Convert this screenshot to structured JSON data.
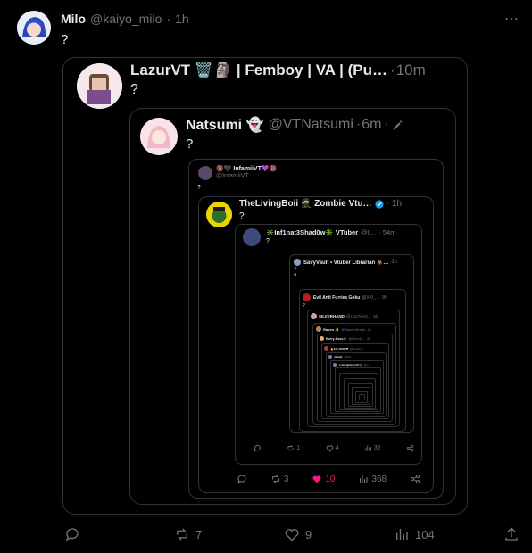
{
  "top": {
    "display_name": "Milo",
    "handle": "@kaiyo_milo",
    "time": "1h",
    "text": "?",
    "more": "⋯",
    "actions": {
      "replies": "",
      "reposts": "7",
      "likes": "9",
      "views": "104"
    }
  },
  "q1": {
    "display_name": "LazurVT 🗑️🗿 | Femboy | VA | (Pu…",
    "dot": "·",
    "time": "10m",
    "text": "?"
  },
  "q2": {
    "display_name": "Natsumi 👻",
    "handle": "@VTNatsumi",
    "dot": "·",
    "time": "6m",
    "text": "?"
  },
  "q3": {
    "display_name": "🔞🖤 InfamiiVT💜🔞",
    "handle": "@InfamiiVT",
    "text": "?"
  },
  "q4": {
    "display_name": "TheLivingBoii 🥷 Zombie Vtu…",
    "time": "1h",
    "text": "?",
    "actions": {
      "reposts": "3",
      "likes": "10",
      "views": "368"
    }
  },
  "q5": {
    "display_name": "✳️Inf1nat3Shad0w✳️ VTuber",
    "handle": "@I…",
    "time": "54m",
    "text": "?",
    "actions": {
      "reposts": "1",
      "likes": "4",
      "views": "32"
    }
  },
  "q6": {
    "display_name": "SavyVault • Vtuber Librarian 🐐…",
    "time": "3h",
    "text": "?"
  },
  "q7": {
    "display_name": "Evil Anti Furries Goku",
    "handle": "@XXI_…",
    "time": "8h",
    "text": "?"
  },
  "q8": {
    "display_name": "SILVERHAND",
    "handle": "@LowTierG…",
    "time": "6h"
  },
  "q9": {
    "display_name": "Raven ✨",
    "handle": "@RavenVtuber",
    "time": "1h"
  },
  "q10": {
    "display_name": "Every-Dove✨",
    "handle": "@EvDv1f…",
    "time": "4h"
  },
  "q11": {
    "display_name": "🔥EX | KING❤",
    "handle": "@ExoKing"
  },
  "q12": {
    "display_name": "mizuki",
    "handle": "@Miz…"
  },
  "q13": {
    "display_name": "✳️midnightmoonVT✳️",
    "handle": "@m…"
  },
  "colors": {
    "bg": "#000000",
    "border": "#2f3336",
    "text": "#e7e9ea",
    "muted": "#71767b",
    "like": "#f91880",
    "verified": "#1d9bf0"
  }
}
